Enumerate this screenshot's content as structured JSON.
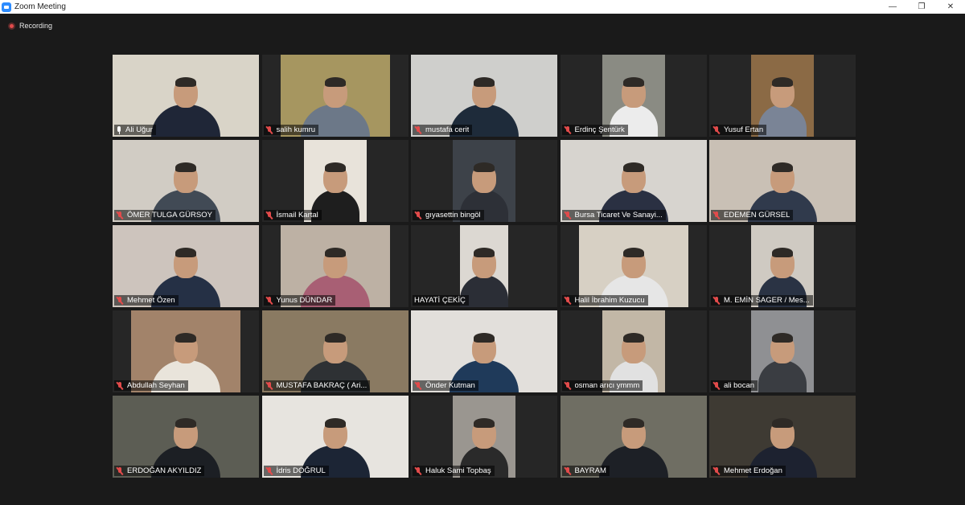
{
  "window": {
    "title": "Zoom Meeting",
    "controls": {
      "minimize": "—",
      "restore": "❐",
      "close": "✕"
    }
  },
  "recording": {
    "label": "Recording",
    "color": "#e04b4b"
  },
  "active_speaker_color": "#c6e04a",
  "participants": [
    {
      "name": "Ali Uğur",
      "muted": false,
      "active": true,
      "video_width": 182,
      "wall": "#d9d4c8",
      "shirt": "#1f2637"
    },
    {
      "name": "salih kumru",
      "muted": true,
      "video_width": 136,
      "wall": "#a69660",
      "shirt": "#6c7888"
    },
    {
      "name": "mustafa cerit",
      "muted": true,
      "video_width": 182,
      "wall": "#cfcfcc",
      "shirt": "#1e2b3a"
    },
    {
      "name": "Erdinç Şentürk",
      "muted": true,
      "video_width": 78,
      "wall": "#8a8b83",
      "shirt": "#ececec"
    },
    {
      "name": "Yusuf Ertan",
      "muted": true,
      "video_width": 78,
      "wall": "#8b6a45",
      "shirt": "#7a8496"
    },
    {
      "name": "ÖMER TULGA GÜRSOY",
      "muted": true,
      "video_width": 182,
      "wall": "#d1ccc4",
      "shirt": "#414a55"
    },
    {
      "name": "İsmail Kartal",
      "muted": true,
      "video_width": 78,
      "wall": "#e8e3da",
      "shirt": "#1e1e1e"
    },
    {
      "name": "gıyasettin bingöl",
      "muted": true,
      "video_width": 78,
      "wall": "#3d4249",
      "shirt": "#2d3037"
    },
    {
      "name": "Bursa Ticaret Ve Sanayi...",
      "muted": true,
      "video_width": 182,
      "wall": "#d7d4cf",
      "shirt": "#2a3042"
    },
    {
      "name": "EDEMEN GÜRSEL",
      "muted": true,
      "video_width": 182,
      "wall": "#c9c0b5",
      "shirt": "#303a4c"
    },
    {
      "name": "Mehmet Özen",
      "muted": true,
      "video_width": 182,
      "wall": "#cdc4bd",
      "shirt": "#253045"
    },
    {
      "name": "Yunus DÜNDAR",
      "muted": true,
      "video_width": 136,
      "wall": "#bdb1a4",
      "shirt": "#a85f74"
    },
    {
      "name": "HAYATİ ÇEKİÇ",
      "muted": false,
      "hide_icon": true,
      "video_width": 60,
      "wall": "#dcd8d2",
      "shirt": "#2b2e36"
    },
    {
      "name": "Halil İbrahim Kuzucu",
      "muted": true,
      "video_width": 136,
      "wall": "#d7d0c4",
      "shirt": "#e6e6e6"
    },
    {
      "name": "M. EMİN SAGER / Mes...",
      "muted": true,
      "video_width": 78,
      "wall": "#cfcac2",
      "shirt": "#2a3344"
    },
    {
      "name": "Abdullah Seyhan",
      "muted": true,
      "video_width": 136,
      "wall": "#a2836a",
      "shirt": "#e9e4db"
    },
    {
      "name": "MUSTAFA BAKRAÇ ( Ari...",
      "muted": true,
      "video_width": 182,
      "wall": "#8a7a62",
      "shirt": "#2e3134"
    },
    {
      "name": "Önder Kutman",
      "muted": true,
      "video_width": 182,
      "wall": "#e2dfdb",
      "shirt": "#1f3a5a"
    },
    {
      "name": "osman arıcı ymmm",
      "muted": true,
      "video_width": 78,
      "wall": "#c2b7a6",
      "shirt": "#e1e1e1"
    },
    {
      "name": "ali bocan",
      "muted": true,
      "video_width": 78,
      "wall": "#8f9093",
      "shirt": "#3a3d42"
    },
    {
      "name": "ERDOĞAN AKYILDIZ",
      "muted": true,
      "video_width": 182,
      "wall": "#5c5d54",
      "shirt": "#1c1f24"
    },
    {
      "name": "İdris DOĞRUL",
      "muted": true,
      "video_width": 182,
      "wall": "#e7e4df",
      "shirt": "#1c2535"
    },
    {
      "name": "Haluk Sami Topbaş",
      "muted": true,
      "video_width": 78,
      "wall": "#9a9690",
      "shirt": "#2a2a2a"
    },
    {
      "name": "BAYRAM",
      "muted": true,
      "video_width": 182,
      "wall": "#6f6e63",
      "shirt": "#1d2026"
    },
    {
      "name": "Mehmet Erdoğan",
      "muted": true,
      "video_width": 182,
      "wall": "#3e3a33",
      "shirt": "#1d2230"
    }
  ]
}
